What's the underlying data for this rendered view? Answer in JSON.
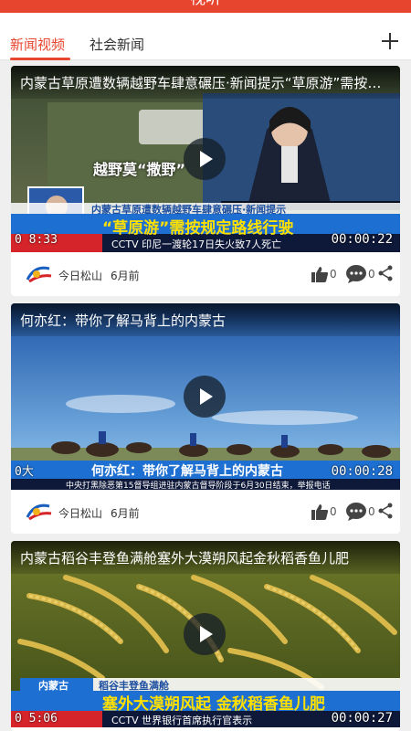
{
  "header": {
    "title": "视听"
  },
  "tabs": [
    {
      "label": "新闻视频"
    },
    {
      "label": "社会新闻"
    }
  ],
  "cards": [
    {
      "title": "内蒙古草原遭数辆越野车肆意碾压·新闻提示“草原游”需按规定路线行驶",
      "inset_text": "越野莫“撒野”",
      "sub_caption": "内蒙古草原遭数辆越野车肆意碾压·新闻提示",
      "main_caption": "“草原游”需按规定路线行驶",
      "ticker": "CCTV 印尼一渡轮17日失火致7人死亡",
      "left_time": "0 8:33",
      "duration": "00:00:22",
      "source": "今日松山",
      "time": "6月前",
      "likes": "0",
      "comments": "0"
    },
    {
      "title": "何亦红：带你了解马背上的内蒙古",
      "sub_caption": "",
      "main_caption": "何亦红：带你了解马背上的内蒙古",
      "ticker": "中央打黑除恶第15督导组进驻内蒙古督导阶段于6月30日结束，举报电话",
      "left_time": "0大",
      "duration": "00:00:28",
      "source": "今日松山",
      "time": "6月前",
      "likes": "0",
      "comments": "0"
    },
    {
      "title": "内蒙古稻谷丰登鱼满舱塞外大漠朔风起金秋稻香鱼儿肥",
      "sub_caption": "稻谷丰登鱼满舱",
      "region_label": "内蒙古",
      "main_caption": "塞外大漠朔风起 金秋稻香鱼儿肥",
      "ticker": "CCTV 世界银行首席执行官表示",
      "left_time": "0 5:06",
      "duration": "00:00:27",
      "source": "今日松山",
      "time": "6月前",
      "likes": "0",
      "comments": "0"
    }
  ],
  "colors": {
    "accent": "#e8452f",
    "caption_blue": "#1d6fd1",
    "caption_yellow": "#ffe000"
  }
}
